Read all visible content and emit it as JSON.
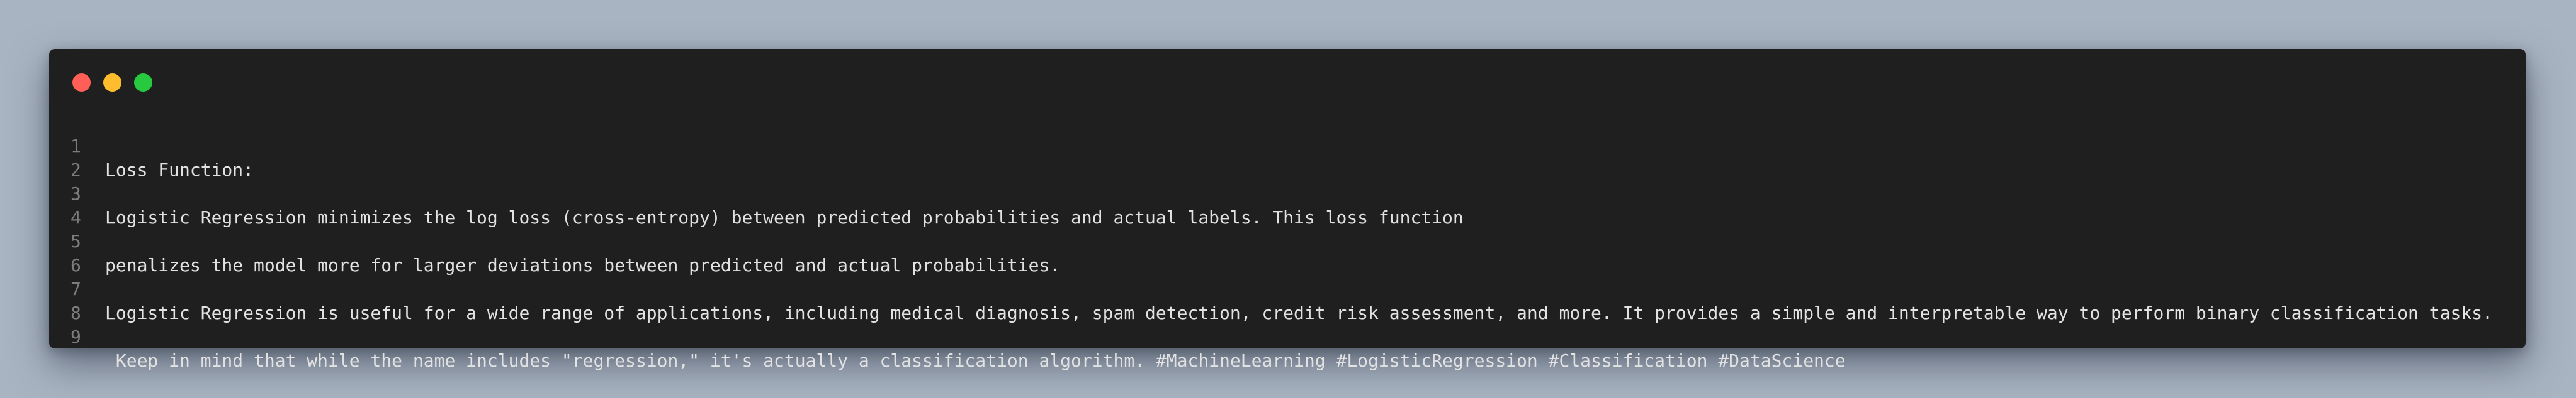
{
  "window": {
    "buttons": {
      "close_color": "#ff5f56",
      "minimize_color": "#ffbd2e",
      "maximize_color": "#27c93f"
    },
    "background_color": "#1f1f1f"
  },
  "code": {
    "lines": [
      {
        "number": "1",
        "text": "Loss Function:"
      },
      {
        "number": "2",
        "text": ""
      },
      {
        "number": "3",
        "text": "Logistic Regression minimizes the log loss (cross-entropy) between predicted probabilities and actual labels. This loss function"
      },
      {
        "number": "4",
        "text": ""
      },
      {
        "number": "5",
        "text": "penalizes the model more for larger deviations between predicted and actual probabilities."
      },
      {
        "number": "6",
        "text": ""
      },
      {
        "number": "7",
        "text": "Logistic Regression is useful for a wide range of applications, including medical diagnosis, spam detection, credit risk assessment, and more. It provides a simple and interpretable way to perform binary classification tasks."
      },
      {
        "number": "8",
        "text": ""
      },
      {
        "number": "9",
        "text": " Keep in mind that while the name includes \"regression,\" it's actually a classification algorithm. #MachineLearning #LogisticRegression #Classification #DataScience"
      }
    ]
  }
}
